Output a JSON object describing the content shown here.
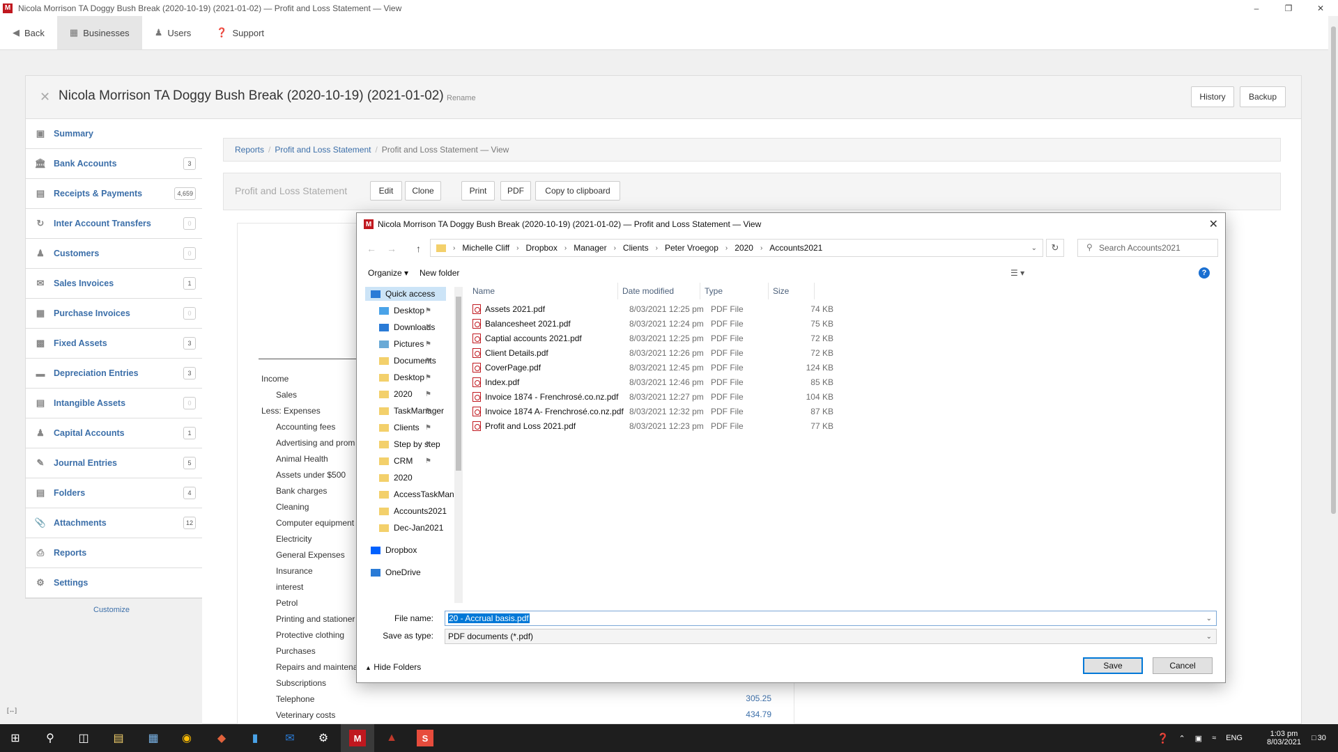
{
  "window": {
    "title": "Nicola Morrison TA Doggy Bush Break (2020-10-19) (2021-01-02) — Profit and Loss Statement  — View",
    "app_icon_letter": "M"
  },
  "topnav": {
    "back": "Back",
    "businesses": "Businesses",
    "users": "Users",
    "support": "Support"
  },
  "business": {
    "name": "Nicola Morrison TA Doggy Bush Break (2020-10-19) (2021-01-02)",
    "rename": "Rename",
    "history": "History",
    "backup": "Backup"
  },
  "sidebar": {
    "items": [
      {
        "label": "Summary",
        "badge": ""
      },
      {
        "label": "Bank Accounts",
        "badge": "3"
      },
      {
        "label": "Receipts & Payments",
        "badge": "4,659"
      },
      {
        "label": "Inter Account Transfers",
        "badge": "0"
      },
      {
        "label": "Customers",
        "badge": "0"
      },
      {
        "label": "Sales Invoices",
        "badge": "1"
      },
      {
        "label": "Purchase Invoices",
        "badge": "0"
      },
      {
        "label": "Fixed Assets",
        "badge": "3"
      },
      {
        "label": "Depreciation Entries",
        "badge": "3"
      },
      {
        "label": "Intangible Assets",
        "badge": "0"
      },
      {
        "label": "Capital Accounts",
        "badge": "1"
      },
      {
        "label": "Journal Entries",
        "badge": "5"
      },
      {
        "label": "Folders",
        "badge": "4"
      },
      {
        "label": "Attachments",
        "badge": "12"
      },
      {
        "label": "Reports",
        "badge": ""
      },
      {
        "label": "Settings",
        "badge": ""
      }
    ],
    "customize": "Customize"
  },
  "breadcrumb": {
    "reports": "Reports",
    "pl": "Profit and Loss Statement",
    "current": "Profit and Loss Statement — View"
  },
  "toolbar": {
    "title": "Profit and Loss Statement",
    "edit": "Edit",
    "clone": "Clone",
    "print": "Print",
    "pdf": "PDF",
    "copy": "Copy to clipboard"
  },
  "report": {
    "income": "Income",
    "sales": "Sales",
    "less_expenses": "Less: Expenses",
    "expenses": [
      "Accounting fees",
      "Advertising and prom",
      "Animal Health",
      "Assets under $500",
      "Bank charges",
      "Cleaning",
      "Computer equipment",
      "Electricity",
      "General Expenses",
      "Insurance",
      "interest",
      "Petrol",
      "Printing and stationer",
      "Protective clothing",
      "Purchases",
      "Repairs and maintena",
      "Subscriptions",
      "Telephone",
      "Veterinary costs"
    ],
    "telephone_value": "305.25",
    "vet_value": "434.79"
  },
  "dialog": {
    "title": "Nicola Morrison TA Doggy Bush Break (2020-10-19) (2021-01-02) — Profit and Loss Statement  — View",
    "path": [
      "Michelle Cliff",
      "Dropbox",
      "Manager",
      "Clients",
      "Peter Vroegop",
      "2020",
      "Accounts2021"
    ],
    "search_placeholder": "Search Accounts2021",
    "organize": "Organize",
    "new_folder": "New folder",
    "nav_items": [
      {
        "label": "Quick access",
        "icon": "star-icon",
        "pinned": false
      },
      {
        "label": "Desktop",
        "icon": "desktop-icon",
        "pinned": true
      },
      {
        "label": "Downloads",
        "icon": "download-icon",
        "pinned": true
      },
      {
        "label": "Pictures",
        "icon": "pictures-icon",
        "pinned": true
      },
      {
        "label": "Documents",
        "icon": "folder-icon",
        "pinned": true
      },
      {
        "label": "Desktop",
        "icon": "folder-icon",
        "pinned": true
      },
      {
        "label": "2020",
        "icon": "folder-icon",
        "pinned": true
      },
      {
        "label": "TaskManager",
        "icon": "folder-icon",
        "pinned": true
      },
      {
        "label": "Clients",
        "icon": "folder-icon",
        "pinned": true
      },
      {
        "label": "Step by step",
        "icon": "folder-icon",
        "pinned": true
      },
      {
        "label": "CRM",
        "icon": "folder-icon",
        "pinned": true
      },
      {
        "label": "2020",
        "icon": "folder-icon",
        "pinned": false
      },
      {
        "label": "AccessTaskMana",
        "icon": "folder-icon",
        "pinned": false
      },
      {
        "label": "Accounts2021",
        "icon": "folder-icon",
        "pinned": false
      },
      {
        "label": "Dec-Jan2021",
        "icon": "folder-icon",
        "pinned": false
      },
      {
        "label": "Dropbox",
        "icon": "dropbox-icon",
        "pinned": false
      },
      {
        "label": "OneDrive",
        "icon": "onedrive-icon",
        "pinned": false
      }
    ],
    "columns": {
      "name": "Name",
      "date": "Date modified",
      "type": "Type",
      "size": "Size"
    },
    "files": [
      {
        "name": "Assets 2021.pdf",
        "date": "8/03/2021 12:25 pm",
        "type": "PDF File",
        "size": "74 KB"
      },
      {
        "name": "Balancesheet 2021.pdf",
        "date": "8/03/2021 12:24 pm",
        "type": "PDF File",
        "size": "75 KB"
      },
      {
        "name": "Captial accounts 2021.pdf",
        "date": "8/03/2021 12:25 pm",
        "type": "PDF File",
        "size": "72 KB"
      },
      {
        "name": "Client Details.pdf",
        "date": "8/03/2021 12:26 pm",
        "type": "PDF File",
        "size": "72 KB"
      },
      {
        "name": "CoverPage.pdf",
        "date": "8/03/2021 12:45 pm",
        "type": "PDF File",
        "size": "124 KB"
      },
      {
        "name": "Index.pdf",
        "date": "8/03/2021 12:46 pm",
        "type": "PDF File",
        "size": "85 KB"
      },
      {
        "name": "Invoice 1874 - Frenchrosé.co.nz.pdf",
        "date": "8/03/2021 12:27 pm",
        "type": "PDF File",
        "size": "104 KB"
      },
      {
        "name": "Invoice 1874 A- Frenchrosé.co.nz.pdf",
        "date": "8/03/2021 12:32 pm",
        "type": "PDF File",
        "size": "87 KB"
      },
      {
        "name": "Profit and Loss 2021.pdf",
        "date": "8/03/2021 12:23 pm",
        "type": "PDF File",
        "size": "77 KB"
      }
    ],
    "file_name_label": "File name:",
    "file_name_value": "20 - Accrual basis.pdf",
    "save_as_label": "Save as type:",
    "save_as_value": "PDF documents (*.pdf)",
    "hide_folders": "Hide Folders",
    "save": "Save",
    "cancel": "Cancel"
  },
  "taskbar": {
    "lang": "ENG",
    "time": "1:03 pm",
    "date": "8/03/2021",
    "notifications": "30"
  }
}
